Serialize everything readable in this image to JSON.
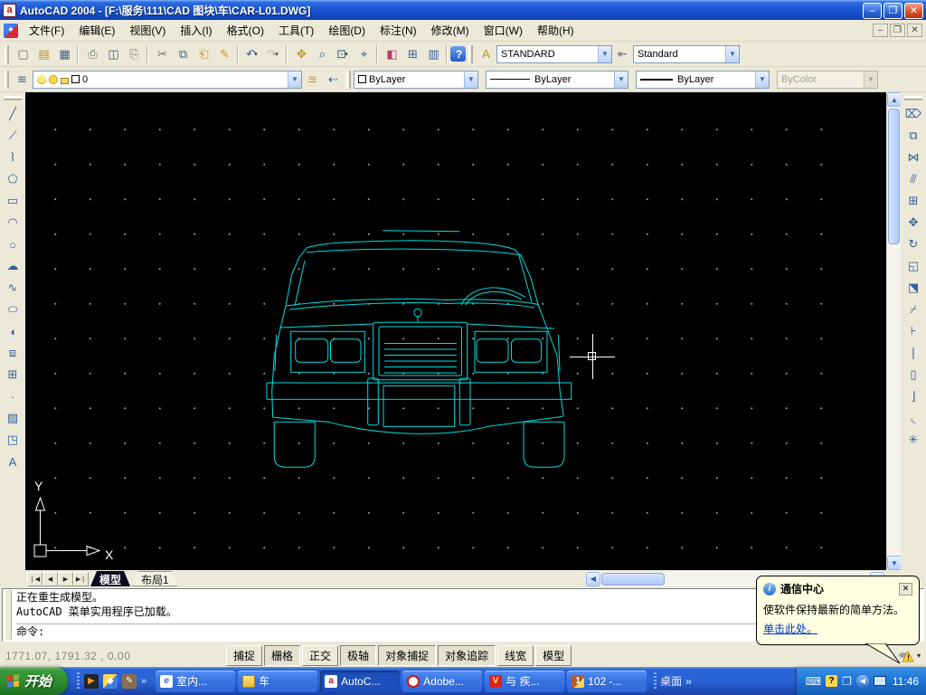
{
  "window": {
    "title": "AutoCAD 2004 - [F:\\服务\\111\\CAD 图块\\车\\CAR-L01.DWG]",
    "app_icon_letter": "a",
    "minimize": "–",
    "restore": "❐",
    "close": "✕"
  },
  "mdi": {
    "minimize": "–",
    "restore": "❐",
    "close": "✕"
  },
  "menu": {
    "items": [
      {
        "name": "menu-file",
        "label": "文件(F)"
      },
      {
        "name": "menu-edit",
        "label": "编辑(E)"
      },
      {
        "name": "menu-view",
        "label": "视图(V)"
      },
      {
        "name": "menu-insert",
        "label": "插入(I)"
      },
      {
        "name": "menu-format",
        "label": "格式(O)"
      },
      {
        "name": "menu-tools",
        "label": "工具(T)"
      },
      {
        "name": "menu-draw",
        "label": "绘图(D)"
      },
      {
        "name": "menu-dimension",
        "label": "标注(N)"
      },
      {
        "name": "menu-modify",
        "label": "修改(M)"
      },
      {
        "name": "menu-window",
        "label": "窗口(W)"
      },
      {
        "name": "menu-help",
        "label": "帮助(H)"
      }
    ]
  },
  "standard_toolbar": {
    "items": [
      {
        "name": "new-icon",
        "glyph": "▢",
        "cls": "c3",
        "arrow": ""
      },
      {
        "name": "open-icon",
        "glyph": "▤",
        "cls": "c2",
        "arrow": ""
      },
      {
        "name": "save-icon",
        "glyph": "▦",
        "cls": "c1",
        "arrow": ""
      },
      {
        "name": "separator",
        "glyph": "",
        "cls": "sep",
        "arrow": ""
      },
      {
        "name": "plot-icon",
        "glyph": "⎙",
        "cls": "c3",
        "arrow": ""
      },
      {
        "name": "plot-preview-icon",
        "glyph": "◫",
        "cls": "c1",
        "arrow": ""
      },
      {
        "name": "publish-icon",
        "glyph": "⎘",
        "cls": "c3",
        "arrow": ""
      },
      {
        "name": "separator",
        "glyph": "",
        "cls": "sep",
        "arrow": ""
      },
      {
        "name": "cut-icon",
        "glyph": "✂",
        "cls": "c3",
        "arrow": ""
      },
      {
        "name": "copy-icon",
        "glyph": "⧉",
        "cls": "c1",
        "arrow": ""
      },
      {
        "name": "paste-icon",
        "glyph": "⎗",
        "cls": "c2",
        "arrow": ""
      },
      {
        "name": "match-properties-icon",
        "glyph": "✎",
        "cls": "c2",
        "arrow": ""
      },
      {
        "name": "separator",
        "glyph": "",
        "cls": "sep",
        "arrow": ""
      },
      {
        "name": "undo-icon",
        "glyph": "↶",
        "cls": "c1",
        "arrow": "▾"
      },
      {
        "name": "redo-icon",
        "glyph": "↷",
        "cls": "c4",
        "arrow": "▾"
      },
      {
        "name": "separator",
        "glyph": "",
        "cls": "sep",
        "arrow": ""
      },
      {
        "name": "pan-icon",
        "glyph": "✥",
        "cls": "c2",
        "arrow": ""
      },
      {
        "name": "zoom-realtime-icon",
        "glyph": "⌕",
        "cls": "c1",
        "arrow": ""
      },
      {
        "name": "zoom-window-icon",
        "glyph": "⊡",
        "cls": "c1",
        "arrow": "▾"
      },
      {
        "name": "zoom-previous-icon",
        "glyph": "⌖",
        "cls": "c1",
        "arrow": ""
      },
      {
        "name": "separator",
        "glyph": "",
        "cls": "sep",
        "arrow": ""
      },
      {
        "name": "properties-icon",
        "glyph": "◧",
        "cls": "c5",
        "arrow": ""
      },
      {
        "name": "designcenter-icon",
        "glyph": "⊞",
        "cls": "c1",
        "arrow": ""
      },
      {
        "name": "tool-palettes-icon",
        "glyph": "▥",
        "cls": "c1",
        "arrow": ""
      },
      {
        "name": "separator",
        "glyph": "",
        "cls": "sep",
        "arrow": ""
      },
      {
        "name": "help-icon",
        "glyph": "?",
        "cls": "chelp",
        "arrow": ""
      }
    ]
  },
  "styles_toolbar": {
    "text_style_value": "STANDARD",
    "dim_style_value": "Standard"
  },
  "layers_toolbar": {
    "layer_value": "0",
    "color_value": "ByLayer",
    "linetype_value": "ByLayer",
    "lineweight_value": "ByLayer",
    "plotstyle_value": "ByColor"
  },
  "draw_toolbar": {
    "items": [
      {
        "name": "line-icon",
        "glyph": "╱"
      },
      {
        "name": "construction-line-icon",
        "glyph": "⟋"
      },
      {
        "name": "polyline-icon",
        "glyph": "⌇"
      },
      {
        "name": "polygon-icon",
        "glyph": "⬠"
      },
      {
        "name": "rectangle-icon",
        "glyph": "▭"
      },
      {
        "name": "arc-icon",
        "glyph": "◠"
      },
      {
        "name": "circle-icon",
        "glyph": "○"
      },
      {
        "name": "revision-cloud-icon",
        "glyph": "☁"
      },
      {
        "name": "spline-icon",
        "glyph": "∿"
      },
      {
        "name": "ellipse-icon",
        "glyph": "⬭"
      },
      {
        "name": "ellipse-arc-icon",
        "glyph": "◖"
      },
      {
        "name": "insert-block-icon",
        "glyph": "⧈"
      },
      {
        "name": "make-block-icon",
        "glyph": "⊞"
      },
      {
        "name": "point-icon",
        "glyph": "·"
      },
      {
        "name": "hatch-icon",
        "glyph": "▨"
      },
      {
        "name": "region-icon",
        "glyph": "◳"
      },
      {
        "name": "multiline-text-icon",
        "glyph": "A"
      }
    ]
  },
  "modify_toolbar": {
    "items": [
      {
        "name": "erase-icon",
        "glyph": "⌦"
      },
      {
        "name": "copy-object-icon",
        "glyph": "⧉"
      },
      {
        "name": "mirror-icon",
        "glyph": "⋈"
      },
      {
        "name": "offset-icon",
        "glyph": "⫻"
      },
      {
        "name": "array-icon",
        "glyph": "⊞"
      },
      {
        "name": "move-icon",
        "glyph": "✥"
      },
      {
        "name": "rotate-icon",
        "glyph": "↻"
      },
      {
        "name": "scale-icon",
        "glyph": "◱"
      },
      {
        "name": "stretch-icon",
        "glyph": "⬔"
      },
      {
        "name": "trim-icon",
        "glyph": "⌿"
      },
      {
        "name": "extend-icon",
        "glyph": "⊦"
      },
      {
        "name": "break-at-point-icon",
        "glyph": "❘"
      },
      {
        "name": "break-icon",
        "glyph": "▯"
      },
      {
        "name": "chamfer-icon",
        "glyph": "⌋"
      },
      {
        "name": "fillet-icon",
        "glyph": "◟"
      },
      {
        "name": "explode-icon",
        "glyph": "✳"
      }
    ]
  },
  "drawing": {
    "object_label": "car front elevation wireframe",
    "line_color": "#00dcdc",
    "ucs_x_label": "X",
    "ucs_y_label": "Y"
  },
  "tabs": {
    "nav": [
      {
        "name": "tab-first-button",
        "glyph": "❘◀"
      },
      {
        "name": "tab-prev-button",
        "glyph": "◀"
      },
      {
        "name": "tab-next-button",
        "glyph": "▶"
      },
      {
        "name": "tab-last-button",
        "glyph": "▶❘"
      }
    ],
    "model_label": "模型",
    "layout1_label": "布局1"
  },
  "command": {
    "line1": "正在重生成模型。",
    "line2": "AutoCAD 菜单实用程序已加载。",
    "prompt": "命令:"
  },
  "status": {
    "coords": "1771.07,  1791.32 ,  0.00",
    "toggles": [
      {
        "name": "toggle-snap",
        "label": "捕捉",
        "state": "raised"
      },
      {
        "name": "toggle-grid",
        "label": "栅格",
        "state": "pressed"
      },
      {
        "name": "toggle-ortho",
        "label": "正交",
        "state": "raised"
      },
      {
        "name": "toggle-polar",
        "label": "极轴",
        "state": "pressed"
      },
      {
        "name": "toggle-osnap",
        "label": "对象捕捉",
        "state": "pressed"
      },
      {
        "name": "toggle-otrack",
        "label": "对象追踪",
        "state": "pressed"
      },
      {
        "name": "toggle-lwt",
        "label": "线宽",
        "state": "raised"
      },
      {
        "name": "toggle-model",
        "label": "模型",
        "state": "raised"
      }
    ],
    "tray_caret": "▾"
  },
  "balloon": {
    "title": "通信中心",
    "info_glyph": "i",
    "text": "使软件保持最新的简单方法。",
    "link": "单击此处。",
    "close": "✕"
  },
  "taskbar": {
    "start_label": "开始",
    "quick_chevron": "»",
    "quick_icons": [
      {
        "name": "media-player-icon",
        "cls": "ql-wmp",
        "glyph": "▶"
      },
      {
        "name": "acdsee-icon",
        "cls": "ql-2",
        "glyph": "◆"
      },
      {
        "name": "paint-icon",
        "cls": "ql-3",
        "glyph": "✎"
      }
    ],
    "tasks": [
      {
        "name": "task-button-indoor",
        "icon": "ico-ie",
        "letter": "e",
        "label": "室内...",
        "cls": ""
      },
      {
        "name": "task-button-car-folder",
        "icon": "ico-folder",
        "letter": "",
        "label": "车",
        "cls": ""
      },
      {
        "name": "task-button-autocad",
        "icon": "ico-acad",
        "letter": "a",
        "label": "AutoC...",
        "cls": "active"
      },
      {
        "name": "task-button-adobe",
        "icon": "ico-adobe",
        "letter": "",
        "label": "Adobe...",
        "cls": ""
      },
      {
        "name": "task-button-vip",
        "icon": "ico-vip",
        "letter": "V",
        "label": "与 疾...",
        "cls": ""
      },
      {
        "name": "task-button-102",
        "icon": "ico-paint",
        "letter": "1",
        "label": "102 -...",
        "cls": ""
      }
    ],
    "desktop_label": "桌面",
    "desktop_chevron": "»",
    "keyboard_glyph": "⌨",
    "help_glyph": "?",
    "window_glyph": "❐",
    "collapse_glyph": "◀",
    "time": "11:46"
  }
}
